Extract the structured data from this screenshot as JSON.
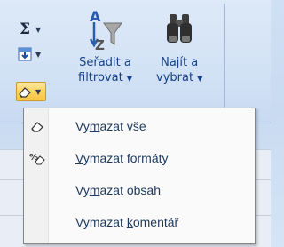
{
  "ribbon": {
    "autosum_icon": "sigma-icon",
    "fill_icon": "fill-down-icon",
    "clear_icon": "eraser-icon",
    "sort_filter": {
      "line1": "Seřadit a",
      "line2": "filtrovat",
      "icon": "sort-filter-icon"
    },
    "find_select": {
      "line1": "Najít a",
      "line2": "vybrat",
      "icon": "binoculars-icon"
    }
  },
  "menu": {
    "items": [
      {
        "label": "Vymazat vše",
        "before": "Vy",
        "key": "m",
        "after": "azat vše",
        "icon": "eraser-icon"
      },
      {
        "label": "Vymazat formáty",
        "before": "",
        "key": "V",
        "after": "ymazat formáty",
        "icon": "clear-formats-icon"
      },
      {
        "label": "Vymazat obsah",
        "before": "Vy",
        "key": "m",
        "after": "azat obsah",
        "icon": ""
      },
      {
        "label": "Vymazat komentář",
        "before": "Vymazat ",
        "key": "k",
        "after": "omentář",
        "icon": ""
      }
    ]
  },
  "colors": {
    "label_blue": "#15428b",
    "menu_text": "#1e395b",
    "active_gold": "#fbd25b"
  }
}
